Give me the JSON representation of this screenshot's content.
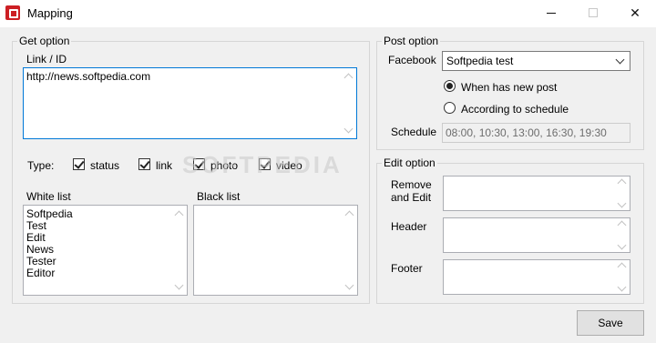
{
  "window": {
    "title": "Mapping",
    "minimize_glyph": "—",
    "close_glyph": "✕"
  },
  "get_option": {
    "label": "Get option",
    "link_label": "Link / ID",
    "link_value": "http://news.softpedia.com",
    "type_label": "Type:",
    "types": [
      {
        "label": "status",
        "checked": true
      },
      {
        "label": "link",
        "checked": true
      },
      {
        "label": "photo",
        "checked": true
      },
      {
        "label": "video",
        "checked": true
      }
    ],
    "white_list_label": "White list",
    "white_list": [
      "Softpedia",
      "Test",
      "Edit",
      "News",
      "Tester",
      "Editor"
    ],
    "black_list_label": "Black list",
    "black_list": []
  },
  "post_option": {
    "label": "Post option",
    "facebook_label": "Facebook",
    "facebook_value": "Softpedia test",
    "radio_new_post": "When has new post",
    "radio_schedule": "According to schedule",
    "selected": "new_post",
    "schedule_label": "Schedule",
    "schedule_value": "08:00, 10:30, 13:00, 16:30, 19:30"
  },
  "edit_option": {
    "label": "Edit option",
    "remove_label": "Remove\nand Edit",
    "header_label": "Header",
    "footer_label": "Footer"
  },
  "save_label": "Save",
  "watermark": "SOFTPEDIA",
  "colors": {
    "app_icon": "#cc1f24",
    "focus_border": "#0078d7"
  }
}
